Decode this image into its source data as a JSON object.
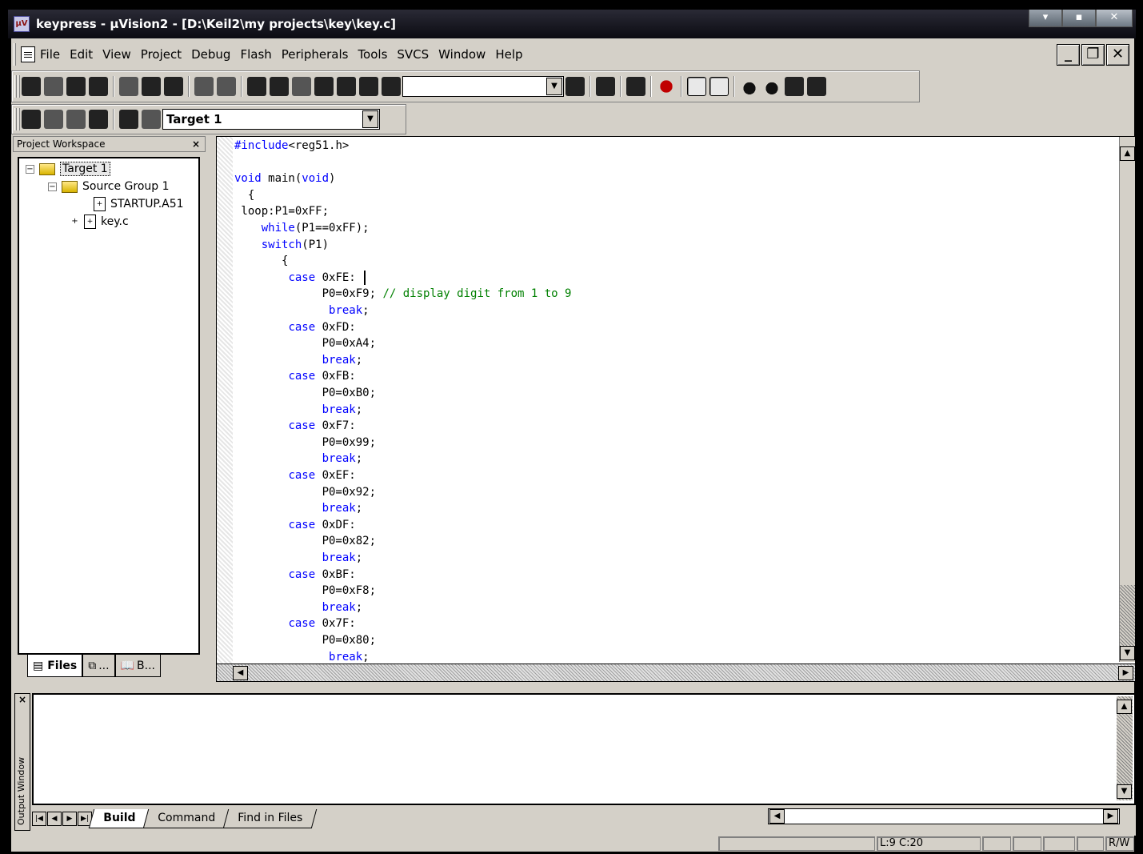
{
  "window": {
    "title": "keypress  - µVision2 - [D:\\Keil2\\my projects\\key\\key.c]"
  },
  "menu": [
    "File",
    "Edit",
    "View",
    "Project",
    "Debug",
    "Flash",
    "Peripherals",
    "Tools",
    "SVCS",
    "Window",
    "Help"
  ],
  "toolbar": {
    "search_value": "",
    "target_value": "Target 1"
  },
  "project_workspace": {
    "title": "Project Workspace",
    "tree": [
      {
        "label": "Target 1"
      },
      {
        "label": "Source Group 1"
      },
      {
        "label": "STARTUP.A51"
      },
      {
        "label": "key.c"
      }
    ],
    "tabs": [
      "Files",
      "...",
      "B..."
    ]
  },
  "editor": {
    "lines": [
      "#include<reg51.h>",
      "",
      "void main(void)",
      "  {",
      " loop:P1=0xFF;",
      "    while(P1==0xFF);",
      "    switch(P1)",
      "       {",
      "        case 0xFE: ",
      "             P0=0xF9; // display digit from 1 to 9",
      "              break;",
      "        case 0xFD:",
      "             P0=0xA4;",
      "             break;",
      "        case 0xFB:",
      "             P0=0xB0;",
      "             break;",
      "        case 0xF7:",
      "             P0=0x99;",
      "             break;",
      "        case 0xEF:",
      "             P0=0x92;",
      "             break;",
      "        case 0xDF:",
      "             P0=0x82;",
      "             break;",
      "        case 0xBF:",
      "             P0=0xF8;",
      "             break;",
      "        case 0x7F:",
      "             P0=0x80;",
      "              break;"
    ]
  },
  "output": {
    "title": "Output Window",
    "tabs": [
      "Build",
      "Command",
      "Find in Files"
    ]
  },
  "status": {
    "position": "L:9 C:20",
    "mode": "R/W"
  }
}
